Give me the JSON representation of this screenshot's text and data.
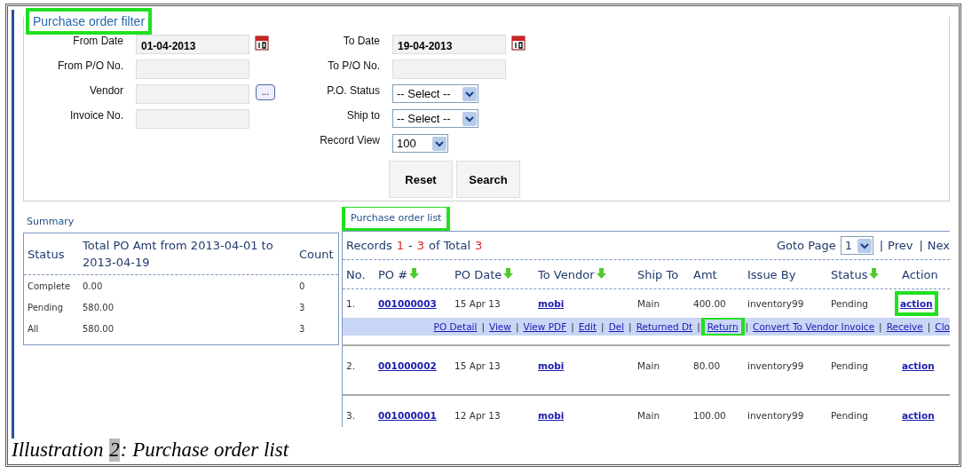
{
  "filter": {
    "title": "Purchase order filter",
    "highlighted": true,
    "left_fields": [
      {
        "kind": "date",
        "label": "From Date",
        "value": "01-04-2013"
      },
      {
        "kind": "text",
        "label": "From P/O No."
      },
      {
        "kind": "lookup",
        "label": "Vendor",
        "button": "..."
      },
      {
        "kind": "text",
        "label": "Invoice No."
      }
    ],
    "right_fields": [
      {
        "kind": "date",
        "label": "To Date",
        "value": "19-04-2013"
      },
      {
        "kind": "text",
        "label": "To P/O No."
      },
      {
        "kind": "select",
        "label": "P.O. Status",
        "value": "-- Select --"
      },
      {
        "kind": "select",
        "label": "Ship to",
        "value": "-- Select --"
      },
      {
        "kind": "short_select",
        "label": "Record View",
        "value": "100"
      }
    ],
    "buttons": [
      "Reset",
      "Search"
    ]
  },
  "summary": {
    "title": "Summary",
    "columns": [
      "Status",
      "Total PO Amt from 2013-04-01 to 2013-04-19",
      "Count"
    ],
    "rows": [
      [
        "Complete",
        "0.00",
        "0"
      ],
      [
        "Pending",
        "580.00",
        "3"
      ],
      [
        "All",
        "580.00",
        "3"
      ]
    ]
  },
  "po_list": {
    "title": "Purchase order list",
    "highlighted": true,
    "records": {
      "label": "Records",
      "from": "1",
      "dash": "-",
      "to": "3",
      "of": "of Total",
      "total": "3"
    },
    "pager": {
      "label": "Goto Page",
      "page": "1",
      "links": [
        "Prev",
        "Nex"
      ],
      "separator": "|"
    },
    "columns": [
      {
        "label": "No.",
        "sortable": false
      },
      {
        "label": "PO #",
        "sortable": true
      },
      {
        "label": "PO Date",
        "sortable": true
      },
      {
        "label": "To Vendor",
        "sortable": true
      },
      {
        "label": "Ship To",
        "sortable": false
      },
      {
        "label": "Amt",
        "sortable": false
      },
      {
        "label": "Issue By",
        "sortable": false
      },
      {
        "label": "Status",
        "sortable": true
      },
      {
        "label": "Action",
        "sortable": false
      }
    ],
    "rows": [
      {
        "no": "1.",
        "po": "001000003",
        "date": "15 Apr 13",
        "vendor": "mobi",
        "ship_to": "Main",
        "amt": "400.00",
        "issue_by": "inventory99",
        "status": "Pending",
        "action": "action",
        "action_highlighted": true,
        "expanded": true,
        "menu": [
          {
            "label": "PO Detail",
            "highlighted": false
          },
          {
            "label": "View",
            "highlighted": false
          },
          {
            "label": "View PDF",
            "highlighted": false
          },
          {
            "label": "Edit",
            "highlighted": false
          },
          {
            "label": "Del",
            "highlighted": false
          },
          {
            "label": "Returned Dt",
            "highlighted": false
          },
          {
            "label": "Return",
            "highlighted": true
          },
          {
            "label": "Convert To Vendor Invoice",
            "highlighted": false
          },
          {
            "label": "Receive",
            "highlighted": false
          },
          {
            "label": "Clo",
            "highlighted": false
          }
        ]
      },
      {
        "no": "2.",
        "po": "001000002",
        "date": "15 Apr 13",
        "vendor": "mobi",
        "ship_to": "Main",
        "amt": "80.00",
        "issue_by": "inventory99",
        "status": "Pending",
        "action": "action",
        "action_highlighted": false,
        "expanded": false
      },
      {
        "no": "3.",
        "po": "001000001",
        "date": "12 Apr 13",
        "vendor": "mobi",
        "ship_to": "Main",
        "amt": "100.00",
        "issue_by": "inventory99",
        "status": "Pending",
        "action": "action",
        "action_highlighted": false,
        "expanded": false
      }
    ],
    "menu_separator": "|"
  },
  "caption": {
    "prefix": "Illustration",
    "number": "2",
    "text": ": Purchase order list"
  }
}
